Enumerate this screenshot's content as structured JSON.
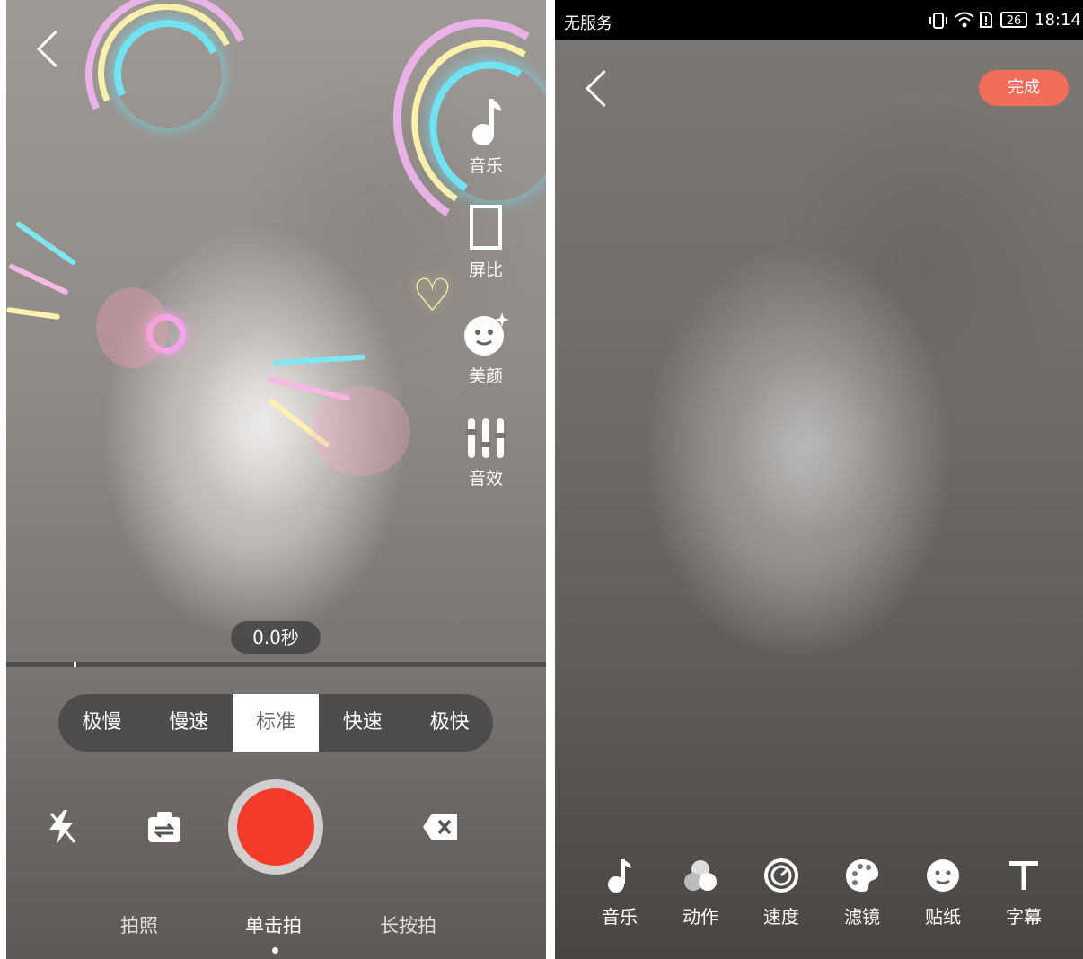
{
  "left": {
    "side_buttons": [
      {
        "label": "音乐",
        "icon": "music-note-icon"
      },
      {
        "label": "屏比",
        "icon": "aspect-ratio-icon"
      },
      {
        "label": "美颜",
        "icon": "beauty-face-icon"
      },
      {
        "label": "音效",
        "icon": "sound-effect-icon"
      }
    ],
    "timer": "0.0秒",
    "speeds": [
      "极慢",
      "慢速",
      "标准",
      "快速",
      "极快"
    ],
    "selected_speed": "标准",
    "modes": [
      "拍照",
      "单击拍",
      "长按拍"
    ],
    "selected_mode": "单击拍",
    "colors": {
      "record": "#f43b2a"
    }
  },
  "right": {
    "status_bar": {
      "carrier": "无服务",
      "battery": "26",
      "time": "18:14"
    },
    "done_label": "完成",
    "tools": [
      {
        "label": "音乐",
        "icon": "music-note-icon"
      },
      {
        "label": "动作",
        "icon": "motion-circles-icon"
      },
      {
        "label": "速度",
        "icon": "speed-gauge-icon"
      },
      {
        "label": "滤镜",
        "icon": "palette-icon"
      },
      {
        "label": "贴纸",
        "icon": "sticker-face-icon"
      },
      {
        "label": "字幕",
        "icon": "text-t-icon"
      }
    ],
    "colors": {
      "done": "#f16d5a"
    }
  }
}
